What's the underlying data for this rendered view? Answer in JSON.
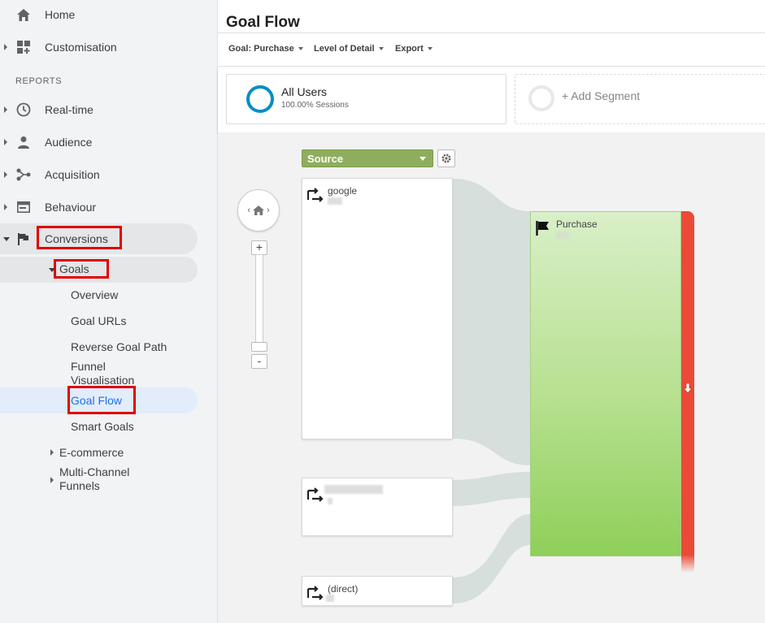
{
  "sidebar": {
    "home": "Home",
    "customisation": "Customisation",
    "reports_heading": "REPORTS",
    "realtime": "Real-time",
    "audience": "Audience",
    "acquisition": "Acquisition",
    "behaviour": "Behaviour",
    "conversions": "Conversions",
    "goals": "Goals",
    "overview": "Overview",
    "goal_urls": "Goal URLs",
    "reverse_goal_path": "Reverse Goal Path",
    "funnel_visualisation": "Funnel\nVisualisation",
    "goal_flow": "Goal Flow",
    "smart_goals": "Smart Goals",
    "ecommerce": "E-commerce",
    "multichannel": "Multi-Channel\nFunnels"
  },
  "page": {
    "title": "Goal Flow"
  },
  "toolbar": {
    "goal": "Goal: Purchase",
    "level": "Level of Detail",
    "export": "Export"
  },
  "segments": {
    "all_users": "All Users",
    "all_users_sub": "100.00% Sessions",
    "add_segment": "+ Add Segment"
  },
  "flow": {
    "dimension_select": "Source",
    "nodes": [
      "google",
      "",
      "(direct)"
    ],
    "goal_name": "Purchase",
    "zoom_in": "+",
    "zoom_out": "-",
    "colors": {
      "goal_top": "#d9efc8",
      "goal_bottom": "#8fcf5a",
      "exit": "#ea4a36",
      "select": "#8fae5d",
      "ring": "#058dc7"
    }
  }
}
